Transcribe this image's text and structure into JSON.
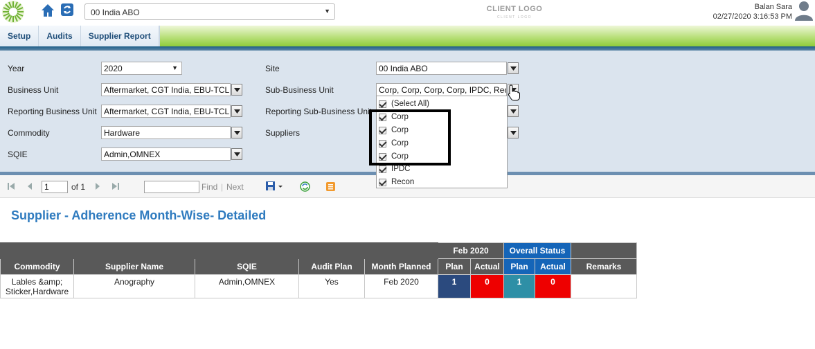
{
  "header": {
    "site_selected": "00 India ABO",
    "client_logo_text": "CLIENT LOGO",
    "client_logo_sub": "CLIENT LOGO",
    "user_name": "Balan Sara",
    "datetime": "02/27/2020 3:16:53 PM"
  },
  "nav": {
    "tabs": [
      "Setup",
      "Audits",
      "Supplier Report"
    ]
  },
  "params": {
    "year_label": "Year",
    "year_value": "2020",
    "site_label": "Site",
    "site_value": "00 India ABO",
    "business_unit_label": "Business Unit",
    "business_unit_value": "Aftermarket, CGT India, EBU-TCL,",
    "sub_business_unit_label": "Sub-Business Unit",
    "sub_business_unit_value": "Corp, Corp, Corp, Corp, IPDC, Recon",
    "reporting_bu_label": "Reporting Business Unit",
    "reporting_bu_value": "Aftermarket, CGT India, EBU-TCL,",
    "reporting_sbu_label": "Reporting Sub-Business Unit",
    "commodity_label": "Commodity",
    "commodity_value": "Hardware",
    "suppliers_label": "Suppliers",
    "sqie_label": "SQIE",
    "sqie_value": "Admin,OMNEX"
  },
  "dropdown": {
    "items": [
      {
        "label": "(Select All)",
        "checked": true
      },
      {
        "label": "Corp",
        "checked": true
      },
      {
        "label": "Corp",
        "checked": true
      },
      {
        "label": "Corp",
        "checked": true
      },
      {
        "label": "Corp",
        "checked": true
      },
      {
        "label": "IPDC",
        "checked": true
      },
      {
        "label": "Recon",
        "checked": true
      }
    ]
  },
  "toolbar": {
    "page_value": "1",
    "of_text": "of 1",
    "find_label": "Find",
    "separator": "|",
    "next_label": "Next"
  },
  "report": {
    "title": "Supplier - Adherence Month-Wise- Detailed",
    "group_month": "Feb 2020",
    "group_overall": "Overall Status",
    "columns": {
      "commodity": "Commodity",
      "supplier": "Supplier Name",
      "sqie": "SQIE",
      "audit_plan": "Audit Plan",
      "month_planned": "Month Planned",
      "plan": "Plan",
      "actual": "Actual",
      "remarks": "Remarks"
    },
    "row": {
      "commodity": "Lables &amp; Sticker,Hardware",
      "supplier": "Anography",
      "sqie": "Admin,OMNEX",
      "audit_plan": "Yes",
      "month_planned": "Feb 2020",
      "month_plan": "1",
      "month_actual": "0",
      "overall_plan": "1",
      "overall_actual": "0",
      "remarks": ""
    }
  },
  "colors": {
    "title_blue": "#2f7bbf",
    "header_dark": "#595959",
    "header_blue": "#1565b8",
    "plan_navy": "#2b4a7e",
    "actual_red": "#ee0000",
    "overall_teal": "#2e8fa6"
  }
}
